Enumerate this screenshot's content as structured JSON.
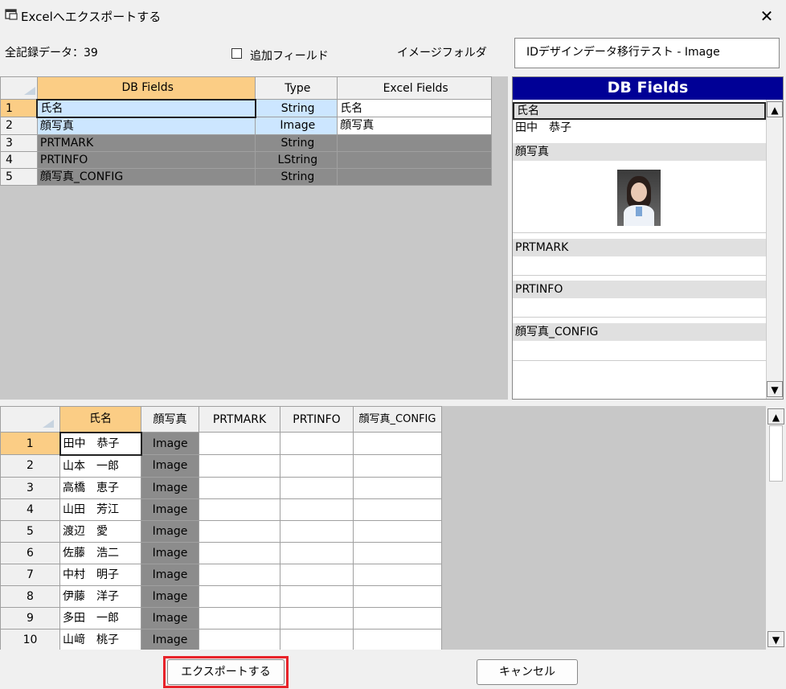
{
  "window": {
    "title": "Excelへエクスポートする",
    "close": "✕"
  },
  "info": {
    "record_count": "全記録データ：39",
    "add_field_label": "追加フィールド",
    "image_folder_label": "イメージフォルダ",
    "image_folder_value": "IDデザインデータ移行テスト - Image"
  },
  "top_grid": {
    "headers": [
      "DB Fields",
      "Type",
      "Excel Fields"
    ],
    "rows": [
      {
        "num": "1",
        "db": "氏名",
        "type": "String",
        "excel": "氏名"
      },
      {
        "num": "2",
        "db": "顔写真",
        "type": "Image",
        "excel": "顔写真"
      },
      {
        "num": "3",
        "db": "PRTMARK",
        "type": "String",
        "excel": ""
      },
      {
        "num": "4",
        "db": "PRTINFO",
        "type": "LString",
        "excel": ""
      },
      {
        "num": "5",
        "db": "顔写真_CONFIG",
        "type": "String",
        "excel": ""
      }
    ]
  },
  "db_panel": {
    "title": "DB Fields",
    "fields": [
      {
        "label": "氏名",
        "value": "田中　恭子"
      },
      {
        "label": "顔写真",
        "value": ""
      },
      {
        "label": "PRTMARK",
        "value": ""
      },
      {
        "label": "PRTINFO",
        "value": ""
      },
      {
        "label": "顔写真_CONFIG",
        "value": ""
      }
    ]
  },
  "bottom_grid": {
    "headers": [
      "氏名",
      "顔写真",
      "PRTMARK",
      "PRTINFO",
      "顔写真_CONFIG"
    ],
    "rows": [
      {
        "num": "1",
        "name": "田中　恭子",
        "photo": "Image"
      },
      {
        "num": "2",
        "name": "山本　一郎",
        "photo": "Image"
      },
      {
        "num": "3",
        "name": "高橋　恵子",
        "photo": "Image"
      },
      {
        "num": "4",
        "name": "山田　芳江",
        "photo": "Image"
      },
      {
        "num": "5",
        "name": "渡辺　愛",
        "photo": "Image"
      },
      {
        "num": "6",
        "name": "佐藤　浩二",
        "photo": "Image"
      },
      {
        "num": "7",
        "name": "中村　明子",
        "photo": "Image"
      },
      {
        "num": "8",
        "name": "伊藤　洋子",
        "photo": "Image"
      },
      {
        "num": "9",
        "name": "多田　一郎",
        "photo": "Image"
      },
      {
        "num": "10",
        "name": "山﨑　桃子",
        "photo": "Image"
      }
    ]
  },
  "footer": {
    "export_label": "エクスポートする",
    "cancel_label": "キャンセル"
  },
  "colors": {
    "selected_header": "#fbcd85",
    "panel_header": "#000096",
    "highlight_border": "#e8232a",
    "selected_row": "#cce6ff",
    "disabled_cell": "#8c8c8c"
  },
  "icons": {
    "window": "window-app-icon",
    "close": "close-icon",
    "scroll_up": "scroll-up-icon",
    "scroll_down": "scroll-down-icon"
  }
}
